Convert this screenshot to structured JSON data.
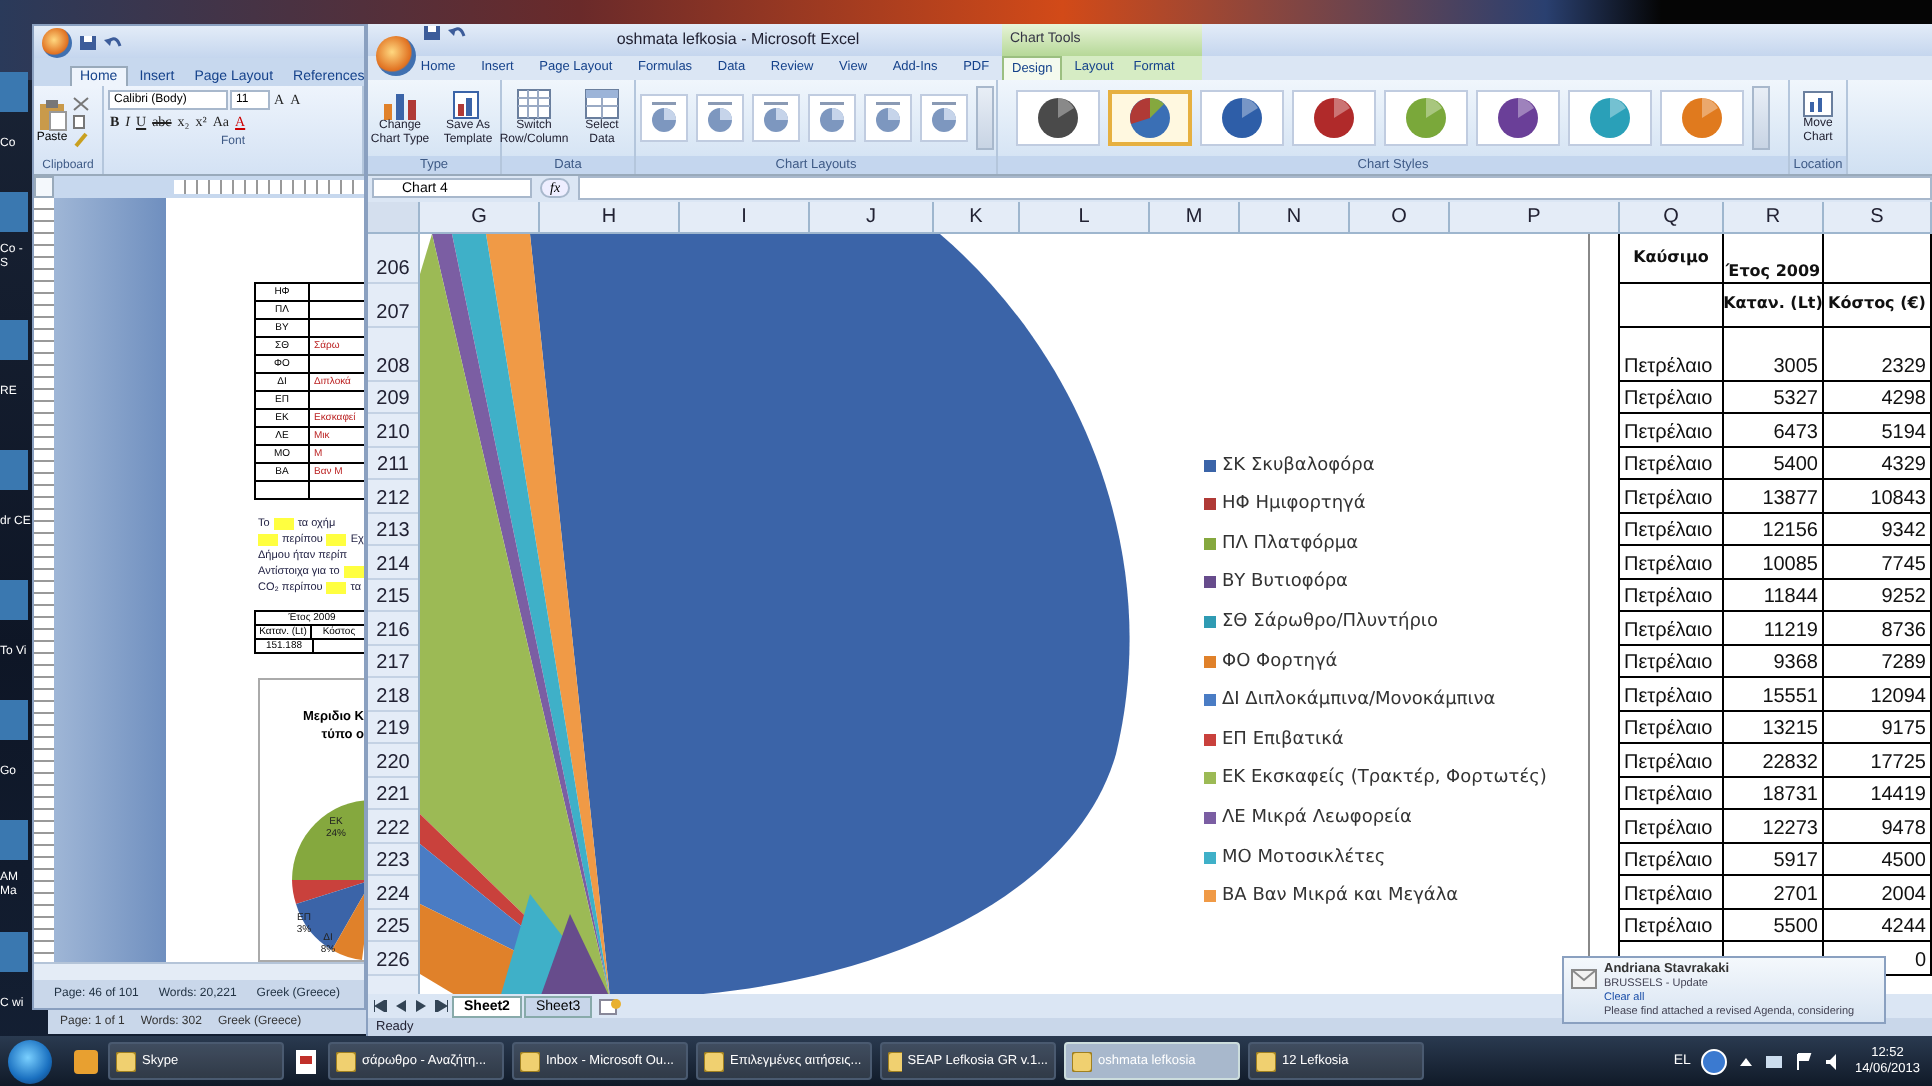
{
  "desktop": {
    "icons": [
      {
        "label": "Co"
      },
      {
        "label": "Co - S"
      },
      {
        "label": "RE"
      },
      {
        "label": "dr CE"
      },
      {
        "label": "To Vi"
      },
      {
        "label": "Go"
      },
      {
        "label": "AM Ma"
      },
      {
        "label": "C wi"
      }
    ]
  },
  "word_back": {
    "status": [
      "Page: 1 of 1",
      "Words: 302",
      "Greek (Greece)"
    ]
  },
  "word": {
    "tabs": [
      {
        "label": "Home",
        "selected": true
      },
      {
        "label": "Insert",
        "selected": false
      },
      {
        "label": "Page Layout",
        "selected": false
      },
      {
        "label": "References",
        "selected": false
      }
    ],
    "paste": "Paste",
    "font_name": "Calibri (Body)",
    "font_size": "11",
    "size_buttons": [
      "A",
      "A"
    ],
    "format_buttons": [
      "B",
      "I",
      "U",
      "abc",
      "x₂",
      "x²",
      "Aa",
      "A"
    ],
    "groups": [
      "Clipboard",
      "Font"
    ],
    "table": [
      {
        "code": "ΗΦ"
      },
      {
        "code": "ΠΛ"
      },
      {
        "code": "ΒΥ"
      },
      {
        "code": "ΣΘ",
        "name": "Σάρω"
      },
      {
        "code": "ΦΟ"
      },
      {
        "code": "ΔΙ",
        "name": "Διπλοκά"
      },
      {
        "code": "ΕΠ"
      },
      {
        "code": "ΕΚ",
        "name": "Εκσκαφεί"
      },
      {
        "code": "ΛΕ",
        "name": "Μικ"
      },
      {
        "code": "ΜΟ",
        "name": "Μ"
      },
      {
        "code": "ΒΑ",
        "name": "Βαν Μ"
      }
    ],
    "paragraph": [
      [
        {
          "kind": "text",
          "text": "Το"
        },
        {
          "kind": "blank"
        },
        {
          "kind": "text",
          "text": "τα οχήμ"
        }
      ],
      [
        {
          "kind": "blank"
        },
        {
          "kind": "text",
          "text": "περίπου"
        },
        {
          "kind": "blank"
        },
        {
          "kind": "text",
          "text": "Εχ"
        }
      ],
      [
        {
          "kind": "text",
          "text": "Δήμου ήταν περίπ"
        }
      ],
      [
        {
          "kind": "text",
          "text": "Αντίστοιχα για το"
        },
        {
          "kind": "blank"
        }
      ],
      [
        {
          "kind": "text",
          "text": "CO₂ περίπου"
        },
        {
          "kind": "blank"
        },
        {
          "kind": "text",
          "text": "τα"
        }
      ]
    ],
    "mini_table": {
      "header": "Έτος 2009",
      "columns": [
        "Καταν. (Lt)",
        "Κόστος"
      ],
      "value": "151.188"
    },
    "mini_chart": {
      "title_lines": [
        "Μεριδιο Κ",
        "τύπο ο"
      ],
      "labels": [
        "ΕΚ 24%",
        "ΕΠ 3%",
        "ΔΙ 8%"
      ]
    },
    "status": [
      "Page: 46 of 101",
      "Words: 20,221",
      "Greek (Greece)"
    ]
  },
  "excel": {
    "title": "oshmata lefkosia - Microsoft Excel",
    "contextual_title": "Chart Tools",
    "tabs": [
      {
        "label": "Home",
        "selected": false
      },
      {
        "label": "Insert",
        "selected": false
      },
      {
        "label": "Page Layout",
        "selected": false
      },
      {
        "label": "Formulas",
        "selected": false
      },
      {
        "label": "Data",
        "selected": false
      },
      {
        "label": "Review",
        "selected": false
      },
      {
        "label": "View",
        "selected": false
      },
      {
        "label": "Add-Ins",
        "selected": false
      },
      {
        "label": "PDF",
        "selected": false
      }
    ],
    "contextual_tabs": [
      {
        "label": "Design",
        "selected": true
      },
      {
        "label": "Layout",
        "selected": false
      },
      {
        "label": "Format",
        "selected": false
      }
    ],
    "type_group": {
      "label": "Type",
      "buttons": [
        "Change Chart Type",
        "Save As Template"
      ]
    },
    "data_group": {
      "label": "Data",
      "buttons": [
        "Switch Row/Column",
        "Select Data"
      ]
    },
    "layouts_label": "Chart Layouts",
    "chart_styles": [
      {
        "kind": "mono",
        "color": "#4a4a4a",
        "selected": false
      },
      {
        "kind": "colorful",
        "color": "#3a6fb5",
        "selected": true
      },
      {
        "kind": "mono",
        "color": "#2e5ea8",
        "selected": false
      },
      {
        "kind": "mono",
        "color": "#b02a2a",
        "selected": false
      },
      {
        "kind": "mono",
        "color": "#7aa83a",
        "selected": false
      },
      {
        "kind": "mono",
        "color": "#6a3f98",
        "selected": false
      },
      {
        "kind": "mono",
        "color": "#2aa0b8",
        "selected": false
      },
      {
        "kind": "mono",
        "color": "#e07a1e",
        "selected": false
      }
    ],
    "styles_label": "Chart Styles",
    "location": {
      "label": "Location",
      "button": "Move Chart"
    },
    "name_box": "Chart 4",
    "fx": "fx",
    "columns": [
      "G",
      "H",
      "I",
      "J",
      "K",
      "L",
      "M",
      "N",
      "O",
      "P",
      "Q",
      "R",
      "S"
    ],
    "row_numbers": [
      "206",
      "207",
      "208",
      "209",
      "210",
      "211",
      "212",
      "213",
      "214",
      "215",
      "216",
      "217",
      "218",
      "219",
      "220",
      "221",
      "222",
      "223",
      "224",
      "225",
      "226"
    ],
    "legend": [
      {
        "label": "ΣΚ Σκυβαλοφόρα",
        "color": "#3b64a8"
      },
      {
        "label": "ΗΦ Ημιφορτηγά",
        "color": "#b03a36"
      },
      {
        "label": "ΠΛ Πλατφόρμα",
        "color": "#85a83e"
      },
      {
        "label": "ΒΥ Βυτιοφόρα",
        "color": "#674c8c"
      },
      {
        "label": "ΣΘ Σάρωθρο/Πλυντήριο",
        "color": "#2f9bb3"
      },
      {
        "label": "ΦΟ Φορτηγά",
        "color": "#e0812a"
      },
      {
        "label": "ΔΙ Διπλοκάμπινα/Μονοκάμπινα",
        "color": "#4a7cc4"
      },
      {
        "label": "ΕΠ Επιβατικά",
        "color": "#c9413c"
      },
      {
        "label": "ΕΚ Εκσκαφείς (Τρακτέρ, Φορτωτές)",
        "color": "#9cba55"
      },
      {
        "label": "ΛΕ Μικρά Λεωφορεία",
        "color": "#7b5ea3"
      },
      {
        "label": "ΜΟ Μοτοσικλέτες",
        "color": "#3fb0c8"
      },
      {
        "label": "ΒΑ Βαν Μικρά και Μεγάλα",
        "color": "#f09a46"
      }
    ],
    "table": {
      "header": {
        "fuel": "Καύσιμο",
        "year": "Έτος 2009"
      },
      "subheader": {
        "consumption": "Καταν. (Lt)",
        "cost": "Κόστος (€)"
      },
      "rows": [
        {
          "fuel": "Πετρέλαιο",
          "consumption": "3005",
          "cost": "2329"
        },
        {
          "fuel": "Πετρέλαιο",
          "consumption": "5327",
          "cost": "4298"
        },
        {
          "fuel": "Πετρέλαιο",
          "consumption": "6473",
          "cost": "5194"
        },
        {
          "fuel": "Πετρέλαιο",
          "consumption": "5400",
          "cost": "4329"
        },
        {
          "fuel": "Πετρέλαιο",
          "consumption": "13877",
          "cost": "10843"
        },
        {
          "fuel": "Πετρέλαιο",
          "consumption": "12156",
          "cost": "9342"
        },
        {
          "fuel": "Πετρέλαιο",
          "consumption": "10085",
          "cost": "7745"
        },
        {
          "fuel": "Πετρέλαιο",
          "consumption": "11844",
          "cost": "9252"
        },
        {
          "fuel": "Πετρέλαιο",
          "consumption": "11219",
          "cost": "8736"
        },
        {
          "fuel": "Πετρέλαιο",
          "consumption": "9368",
          "cost": "7289"
        },
        {
          "fuel": "Πετρέλαιο",
          "consumption": "15551",
          "cost": "12094"
        },
        {
          "fuel": "Πετρέλαιο",
          "consumption": "13215",
          "cost": "9175"
        },
        {
          "fuel": "Πετρέλαιο",
          "consumption": "22832",
          "cost": "17725"
        },
        {
          "fuel": "Πετρέλαιο",
          "consumption": "18731",
          "cost": "14419"
        },
        {
          "fuel": "Πετρέλαιο",
          "consumption": "12273",
          "cost": "9478"
        },
        {
          "fuel": "Πετρέλαιο",
          "consumption": "5917",
          "cost": "4500"
        },
        {
          "fuel": "Πετρέλαιο",
          "consumption": "2701",
          "cost": "2004"
        },
        {
          "fuel": "Πετρέλαιο",
          "consumption": "5500",
          "cost": "4244"
        },
        {
          "cost": "0"
        }
      ]
    },
    "sheet_tabs": [
      {
        "label": "Sheet2",
        "selected": true
      },
      {
        "label": "Sheet3",
        "selected": false
      }
    ],
    "status": "Ready"
  },
  "notification": {
    "sender": "Andriana Stavrakaki",
    "subject": "BRUSSELS - Update",
    "action": "Clear all",
    "preview": "Please find attached a revised Agenda, considering"
  },
  "taskbar": {
    "items": [
      {
        "label": "Skype",
        "selected": false
      },
      {
        "label": "σάρωθρο - Αναζήτη...",
        "selected": false
      },
      {
        "label": "Inbox - Microsoft Ou...",
        "selected": false
      },
      {
        "label": "Επιλεγμένες αιτήσεις...",
        "selected": false
      },
      {
        "label": "SEAP Lefkosia GR v.1...",
        "selected": false
      },
      {
        "label": "oshmata lefkosia",
        "selected": true
      },
      {
        "label": "12 Lefkosia",
        "selected": false
      }
    ],
    "language": "EL",
    "time": "12:52",
    "date": "14/06/2013"
  }
}
